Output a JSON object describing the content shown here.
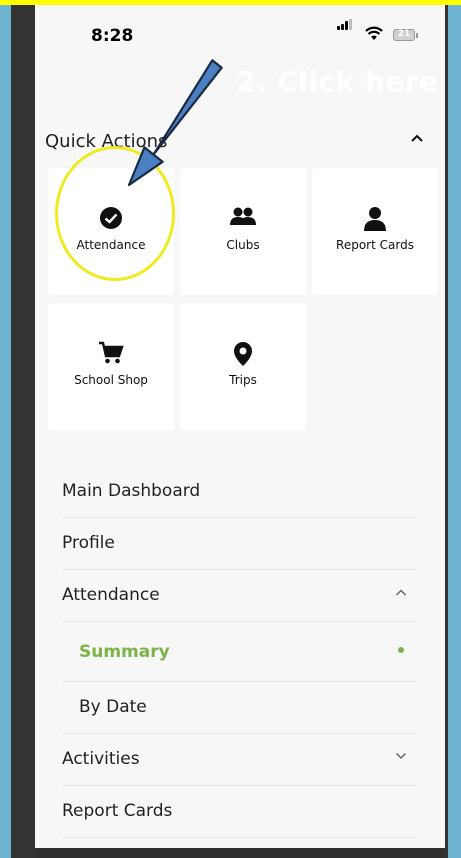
{
  "status_bar": {
    "time": "8:28",
    "battery": "21"
  },
  "annotation": {
    "text": "2.  Click here"
  },
  "quick_actions": {
    "title": "Quick Actions",
    "tiles": [
      {
        "label": "Attendance",
        "icon": "check-circle-icon"
      },
      {
        "label": "Clubs",
        "icon": "people-icon"
      },
      {
        "label": "Report Cards",
        "icon": "person-icon"
      },
      {
        "label": "School Shop",
        "icon": "cart-icon"
      },
      {
        "label": "Trips",
        "icon": "location-pin-icon"
      }
    ]
  },
  "menu": {
    "items": [
      {
        "label": "Main Dashboard"
      },
      {
        "label": "Profile"
      },
      {
        "label": "Attendance",
        "chevron": "up"
      },
      {
        "label": "Summary",
        "active": true
      },
      {
        "label": "By Date"
      },
      {
        "label": "Activities",
        "chevron": "down"
      },
      {
        "label": "Report Cards"
      }
    ]
  },
  "colors": {
    "accent": "#7bb446",
    "highlight": "#f2ea1f",
    "arrow": "#4a7fc1"
  }
}
